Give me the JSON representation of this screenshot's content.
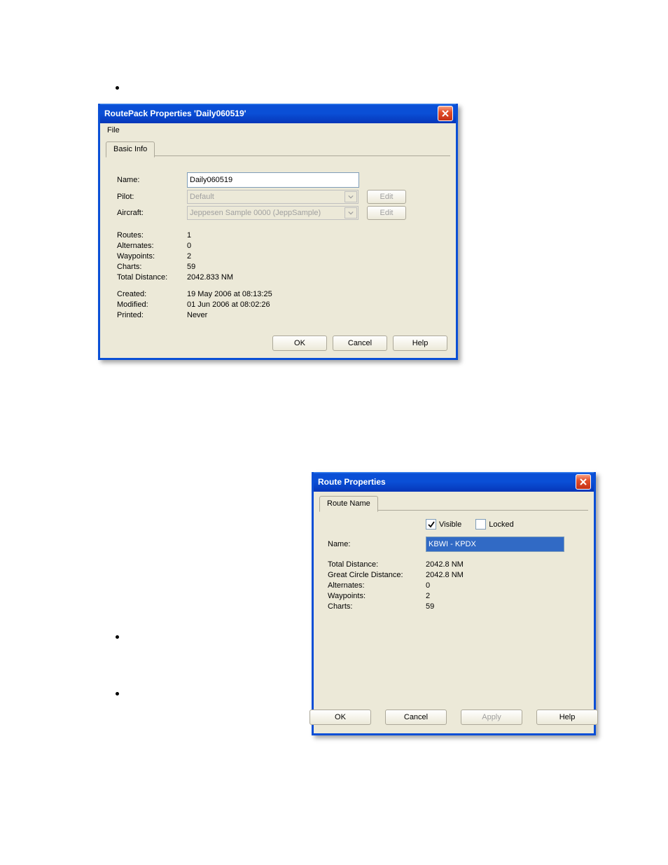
{
  "bullets": true,
  "window1": {
    "title": "RoutePack Properties 'Daily060519'",
    "menu_file": "File",
    "tab": "Basic Info",
    "labels": {
      "name": "Name:",
      "pilot": "Pilot:",
      "aircraft": "Aircraft:",
      "routes": "Routes:",
      "alternates": "Alternates:",
      "waypoints": "Waypoints:",
      "charts": "Charts:",
      "total_distance": "Total Distance:",
      "created": "Created:",
      "modified": "Modified:",
      "printed": "Printed:"
    },
    "values": {
      "name": "Daily060519",
      "pilot": "Default",
      "aircraft": "Jeppesen Sample 0000 (JeppSample)",
      "routes": "1",
      "alternates": "0",
      "waypoints": "2",
      "charts": "59",
      "total_distance": "2042.833 NM",
      "created": "19 May 2006 at 08:13:25",
      "modified": "01 Jun 2006 at 08:02:26",
      "printed": "Never"
    },
    "buttons": {
      "edit": "Edit",
      "ok": "OK",
      "cancel": "Cancel",
      "help": "Help"
    }
  },
  "window2": {
    "title": "Route Properties",
    "tab": "Route Name",
    "checks": {
      "visible": "Visible",
      "locked": "Locked"
    },
    "check_state": {
      "visible": true,
      "locked": false
    },
    "labels": {
      "name": "Name:",
      "total_distance": "Total Distance:",
      "gcd": "Great Circle Distance:",
      "alternates": "Alternates:",
      "waypoints": "Waypoints:",
      "charts": "Charts:"
    },
    "values": {
      "name": "KBWI - KPDX",
      "total_distance": "2042.8 NM",
      "gcd": "2042.8 NM",
      "alternates": "0",
      "waypoints": "2",
      "charts": "59"
    },
    "buttons": {
      "ok": "OK",
      "cancel": "Cancel",
      "apply": "Apply",
      "help": "Help"
    }
  }
}
